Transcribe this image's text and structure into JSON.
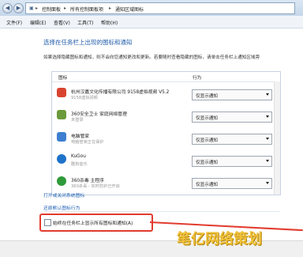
{
  "address": {
    "crumbs": [
      "控制面板",
      "所有控制面板项",
      "通知区域图标"
    ],
    "separator": "▸",
    "back_icon": "back-arrow-icon",
    "forward_icon": "forward-arrow-icon"
  },
  "menu": [
    "文件(F)",
    "编辑(E)",
    "查看(V)",
    "工具(T)",
    "帮助(H)"
  ],
  "page": {
    "title": "选择在任务栏上出现的图标和通知",
    "description": "如果选择隐藏图标和通知，则不会向您通知更改和更新。若要随时查看隐藏的图标，请单击任务栏上通知区域旁"
  },
  "list": {
    "col_icon": "图标",
    "col_behavior": "行为",
    "rows": [
      {
        "name": "杭州汉嘉文化传播有限公司 9158虚拟视频 V5.2",
        "sub": "9158虚拟视频",
        "value": "仅显示通知",
        "icon_color": "#d8432f",
        "icon": "9158-app-icon"
      },
      {
        "name": "360安全卫士 家庭网络管理",
        "sub": "未登录",
        "value": "仅显示通知",
        "icon_color": "#6a9a3a",
        "icon": "360-safeguard-icon"
      },
      {
        "name": "电脑管家",
        "sub": "电脑管家正在保护",
        "value": "仅显示通知",
        "icon_color": "#3e7fd0",
        "icon": "pc-manager-icon"
      },
      {
        "name": "KuGou",
        "sub": "酷狗音乐",
        "value": "仅显示通知",
        "icon_color": "#1f73c9",
        "icon": "kugou-icon"
      },
      {
        "name": "360杀毒 主程序",
        "sub": "360杀毒 - 实时防护已开启",
        "value": "仅显示通知",
        "icon_color": "#2f9a3a",
        "icon": "360-antivirus-icon"
      }
    ]
  },
  "links": {
    "system_icons": "打开或关闭系统图标",
    "restore": "还原默认图标行为"
  },
  "checkbox": {
    "label": "始终在任务栏上显示所有图标和通知(A)",
    "checked": false
  },
  "watermark": "笔亿网络策划",
  "colors": {
    "link": "#1c5fb3",
    "title": "#1e5aa8",
    "highlight": "#e23b2e",
    "watermark": "#f0c13a"
  }
}
